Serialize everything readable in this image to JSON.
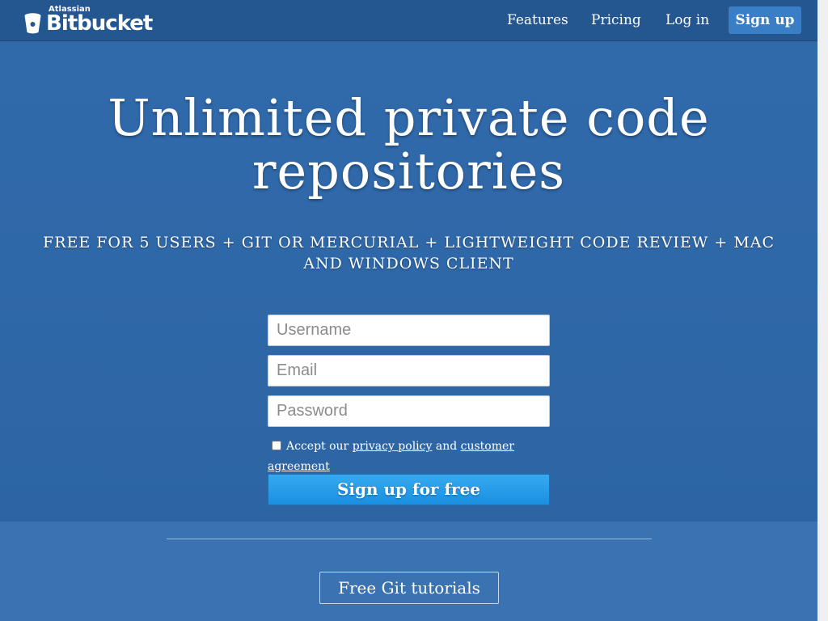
{
  "header": {
    "logo_small": "Atlassian",
    "logo_brand": "Bitbucket",
    "nav": [
      "Features",
      "Pricing",
      "Log in"
    ],
    "signup_label": "Sign up"
  },
  "hero": {
    "headline": "Unlimited private code repositories",
    "features": "FREE FOR 5 USERS  + GIT OR MERCURIAL  + LIGHTWEIGHT CODE REVIEW  + MAC AND WINDOWS CLIENT"
  },
  "form": {
    "username_placeholder": "Username",
    "email_placeholder": "Email",
    "password_placeholder": "Password",
    "accept_prefix": "Accept our",
    "privacy_link": "privacy policy",
    "accept_and": "and",
    "agreement_link": "customer agreement",
    "submit_label": "Sign up for free"
  },
  "lower": {
    "tutorials_label": "Free Git tutorials"
  },
  "colors": {
    "background": "#2f66a6",
    "header": "#24568f",
    "cta": "#1a8fe0"
  }
}
